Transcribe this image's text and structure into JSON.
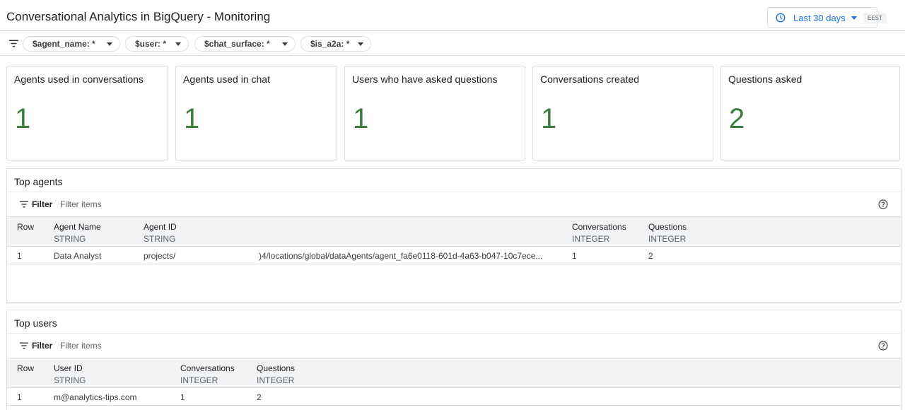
{
  "header": {
    "title": "Conversational Analytics in BigQuery - Monitoring",
    "date_range": "Last 30 days",
    "timezone": "EEST",
    "icon": "clock-icon"
  },
  "filters": [
    {
      "label": "$agent_name: *"
    },
    {
      "label": "$user: *"
    },
    {
      "label": "$chat_surface: *"
    },
    {
      "label": "$is_a2a: *"
    }
  ],
  "scorecards": [
    {
      "title": "Agents used in conversations",
      "value": "1"
    },
    {
      "title": "Agents used in chat",
      "value": "1"
    },
    {
      "title": "Users who have asked questions",
      "value": "1"
    },
    {
      "title": "Conversations created",
      "value": "1"
    },
    {
      "title": "Questions asked",
      "value": "2"
    }
  ],
  "colors": {
    "accent": "#1a73e8",
    "metric": "#3d7d3f",
    "header_bg": "#f1f3f4"
  },
  "top_agents": {
    "title": "Top agents",
    "filter_label": "Filter",
    "filter_placeholder": "Filter items",
    "columns": [
      {
        "name": "Row",
        "type": ""
      },
      {
        "name": "Agent Name",
        "type": "STRING"
      },
      {
        "name": "Agent ID",
        "type": "STRING"
      },
      {
        "name": "Conversations",
        "type": "INTEGER"
      },
      {
        "name": "Questions",
        "type": "INTEGER"
      }
    ],
    "rows": [
      {
        "row": "1",
        "agent_name": "Data Analyst",
        "agent_id_start": "projects/",
        "agent_id_end": ")4/locations/global/dataAgents/agent_fa6e0118-601d-4a63-b047-10c7ece...",
        "conversations": "1",
        "questions": "2"
      }
    ]
  },
  "top_users": {
    "title": "Top users",
    "filter_label": "Filter",
    "filter_placeholder": "Filter items",
    "columns": [
      {
        "name": "Row",
        "type": ""
      },
      {
        "name": "User ID",
        "type": "STRING"
      },
      {
        "name": "Conversations",
        "type": "INTEGER"
      },
      {
        "name": "Questions",
        "type": "INTEGER"
      }
    ],
    "rows": [
      {
        "row": "1",
        "user_id": "m@analytics-tips.com",
        "conversations": "1",
        "questions": "2"
      }
    ]
  }
}
